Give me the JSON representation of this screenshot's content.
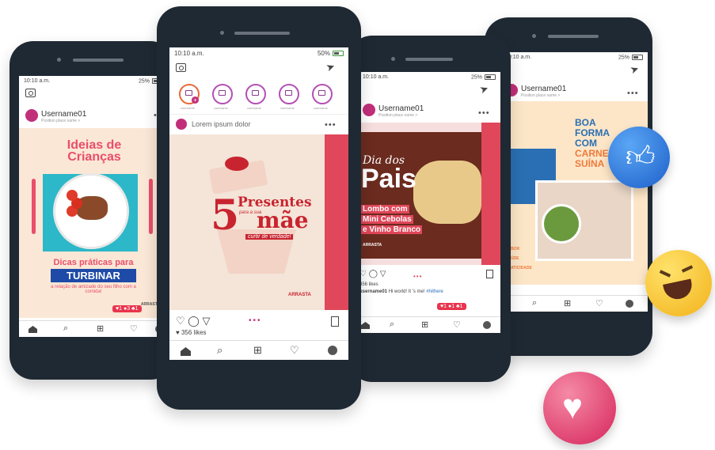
{
  "phone1": {
    "time": "10:10 a.m.",
    "signal": "25%",
    "username": "Username01",
    "location": "Position place name >",
    "post_title": "Ideias de Crianças",
    "post_sub1": "Dicas práticas para",
    "post_sub2": "TURBINAR",
    "post_sub3": "a relação de amizade do seu filho com a comida!",
    "brand": "ARRASTA",
    "notif": "♥1 ●3 ♣1"
  },
  "phone2": {
    "time": "10:10 a.m.",
    "signal": "50%",
    "stories": [
      "username",
      "username",
      "username",
      "username",
      "username"
    ],
    "post_caption": "Lorem ipsum dolor",
    "big_num": "5",
    "presentes": "Presentes",
    "para": "para a sua",
    "mae": "mãe",
    "curtir": "curtir de verdade!",
    "brand": "ARRASTA",
    "likes": "356 likes",
    "colors": {
      "accent": "#e0475a",
      "bg": "#f5e4d8"
    }
  },
  "phone3": {
    "time": "10:10 a.m.",
    "signal": "25%",
    "username": "Username01",
    "location": "Position place name >",
    "dia": "Dia dos",
    "pais": "Pais",
    "dish1": "Lombo com",
    "dish2": "Mini Cebolas",
    "dish3": "e Vinho Branco",
    "brand": "ARRASTA",
    "likes": "356 likes",
    "comment_user": "username01",
    "comment": "Hi world! It 's me!",
    "hashtag": "#hithere",
    "notif": "♥1 ●1 ♣1"
  },
  "phone4": {
    "time": "10:10 a.m.",
    "signal": "25%",
    "username": "Username01",
    "location": "Position place name >",
    "line1": "BOA",
    "line2": "FORMA",
    "line3": "COM",
    "line4": "CARNE",
    "line5": "SUÍNA",
    "tags": [
      "SABOR",
      "SAÚDE",
      "PRATICIDADE"
    ]
  },
  "icons": [
    "like-emoji",
    "laugh-emoji",
    "heart-emoji"
  ]
}
